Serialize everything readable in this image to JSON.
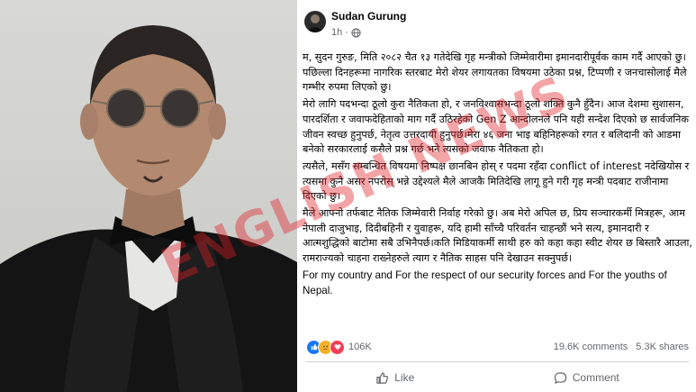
{
  "post": {
    "author": "Sudan Gurung",
    "time": "1h",
    "privacy_icon": "globe-icon",
    "paragraphs": [
      "म, सुदन गुरुङ, मिति २०८२ चैत १३ गतेदेखि गृह मन्त्रीको जिम्मेवारीमा इमानदारीपूर्वक काम गर्दै आएको छु। पछिल्ला दिनहरूमा नागरिक स्तरबाट मेरो शेयर लगायतका विषयमा उठेका प्रश्न, टिप्पणी र जनचासोलाई मैले गम्भीर रुपमा लिएको छु।",
      "मेरो लागि पदभन्दा ठूलो कुरा नैतिकता हो, र जनविश्वासभन्दा ठूलो शक्ति कुनै हुँदैन। आज देशमा सुशासन, पारदर्शिता र जवाफदेहिताको माग गर्दै उठिरहेको Gen Z आन्दोलनले पनि यही सन्देश दिएको छ सार्वजनिक जीवन स्वच्छ हुनुपर्छ, नेतृत्व उत्तरदायी हुनुपर्छ।मेरा ४६ जना भाइ बहिनिहरूको रगत र बलिदानी को आडमा बनेको सरकारलाई कसैले प्रश्न गर्छ भने त्यसको जवाफ नैतिकता हो।",
      "त्यसैले, मसँग सम्बन्धित विषयमा निष्पक्ष छानबिन होस् र पदमा रहँदा conflict of interest नदेखियोस र त्यसमा कुनै असर नपरोस् भन्ने उद्देश्यले मैले आजकै मितिदेखि लागू हुने गरी गृह मन्त्री पदबाट राजीनामा दिएको छु।",
      "मैले आफ्नो तर्फबाट नैतिक जिम्मेवारी निर्वाह गरेको छु। अब मेरो अपिल छ, प्रिय सञ्चारकर्मी मित्रहरू, आम नेपाली दाजुभाइ, दिदीबहिनी र युवाहरू, यदि हामी साँच्चै परिवर्तन चाहन्छौं भने सत्य, इमानदारी र आत्मशुद्धिको बाटोमा सबै उभिनैपर्छ।कति मिडियाकर्मी साथी हरु को कहा कहा स्वीट शेयर छ बिस्तारै आउला, रामराज्यको चाहना राख्नेहरुले त्याग र नैतिक साहस पनि देखाउन सक्नुपर्छ।",
      "For my country and For the respect of our security forces and For the youths of Nepal."
    ]
  },
  "reactions": {
    "icons": [
      "like-icon",
      "sad-icon",
      "love-icon"
    ],
    "count": "106K",
    "comments": "19.6K comments",
    "shares": "5.3K shares"
  },
  "actions": {
    "like_label": "Like",
    "comment_label": "Comment"
  },
  "watermark": {
    "text": "ENGLISH NEWS",
    "color": "#e21c24"
  },
  "colors": {
    "meta_gray": "#65676b",
    "like_blue": "#1877f2",
    "love_red": "#f33e58",
    "sad_yellow": "#f7b125"
  }
}
